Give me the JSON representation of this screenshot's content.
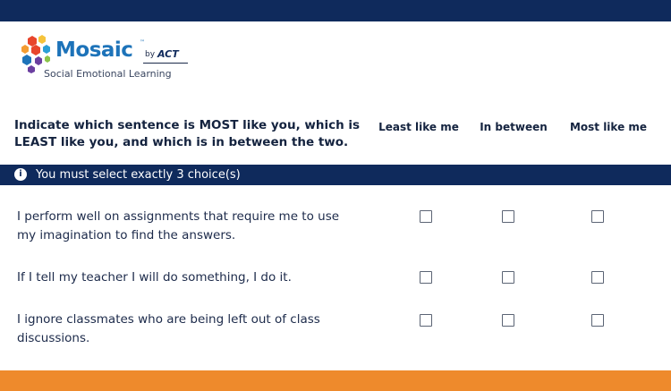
{
  "logo": {
    "brand": "Mosaic",
    "trademark": "™",
    "by": "by",
    "publisher": "ACT",
    "tagline": "Social Emotional Learning",
    "colors": [
      "#e8452c",
      "#f39c32",
      "#f5c33b",
      "#1d73b9",
      "#2a9fd6",
      "#6b3fa0",
      "#8bc34a"
    ]
  },
  "question": {
    "prompt": "Indicate which sentence is MOST like you, which is LEAST like you, and which is in between the two."
  },
  "columns": [
    "Least like me",
    "In between",
    "Most like me"
  ],
  "notice": {
    "icon": "info-icon",
    "text": "You must select exactly 3 choice(s)"
  },
  "statements": [
    {
      "text": "I perform well on assignments that require me to use my imagination to find the answers."
    },
    {
      "text": "If I tell my teacher I will do something, I do it."
    },
    {
      "text": "I ignore classmates who are being left out of class discussions."
    }
  ],
  "colors": {
    "header_bar": "#0f2a5c",
    "footer_bar": "#ee8a2c",
    "brand_blue": "#1d73b9"
  }
}
